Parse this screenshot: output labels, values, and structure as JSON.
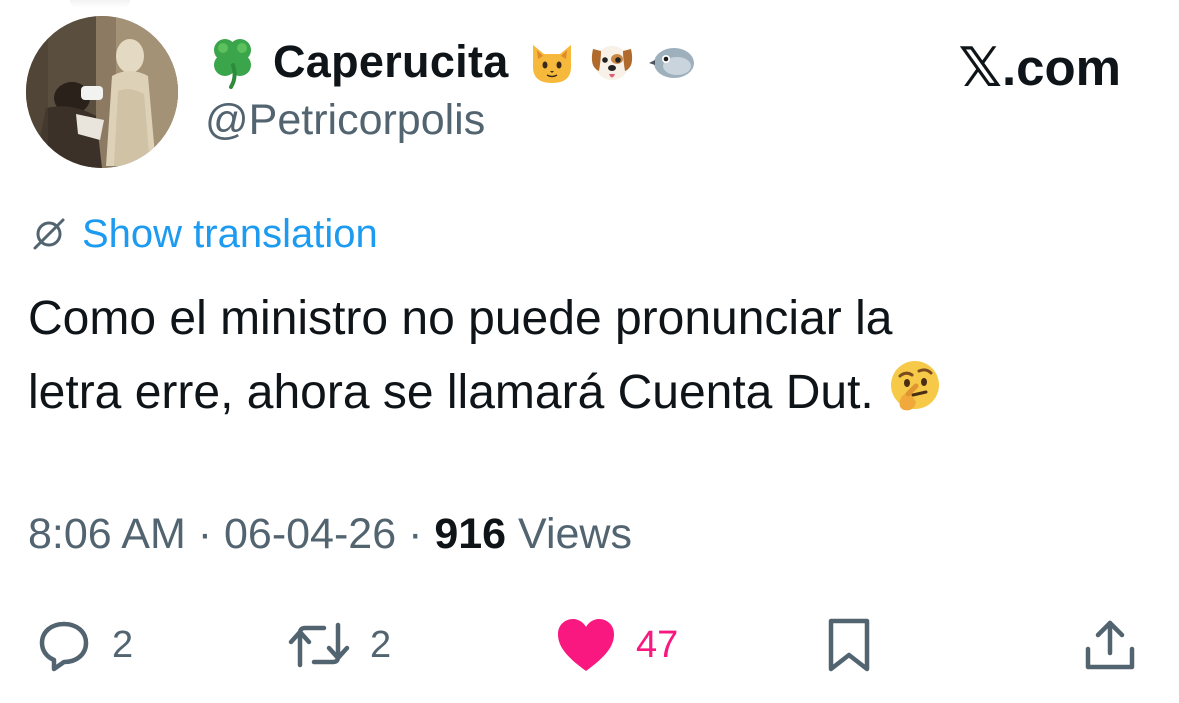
{
  "author": {
    "display_name": "Caperucita",
    "handle": "@Petricorpolis",
    "name_prefix_icon": "four-leaf-clover-icon",
    "name_suffix_icons": [
      "cat-face-icon",
      "dog-face-icon",
      "bird-icon"
    ]
  },
  "brand": {
    "site_text": ".com",
    "logo_glyph": "𝕏"
  },
  "translation": {
    "label": "Show translation",
    "icon": "globe-slash-icon"
  },
  "tweet": {
    "line1": "Como el ministro no puede pronunciar la",
    "line2": "letra erre, ahora se llamará Cuenta Dut.",
    "trailing_emoji": "thinking-face-icon"
  },
  "meta": {
    "time": "8:06 AM",
    "separator": " · ",
    "date": "06-04-26",
    "views_count": "916",
    "views_label": " Views"
  },
  "actions": {
    "replies": "2",
    "reposts": "2",
    "likes": "47",
    "liked": true
  },
  "colors": {
    "accent": "#1d9bf0",
    "like": "#f91880",
    "secondary_text": "#536471",
    "primary_text": "#0f1419"
  }
}
